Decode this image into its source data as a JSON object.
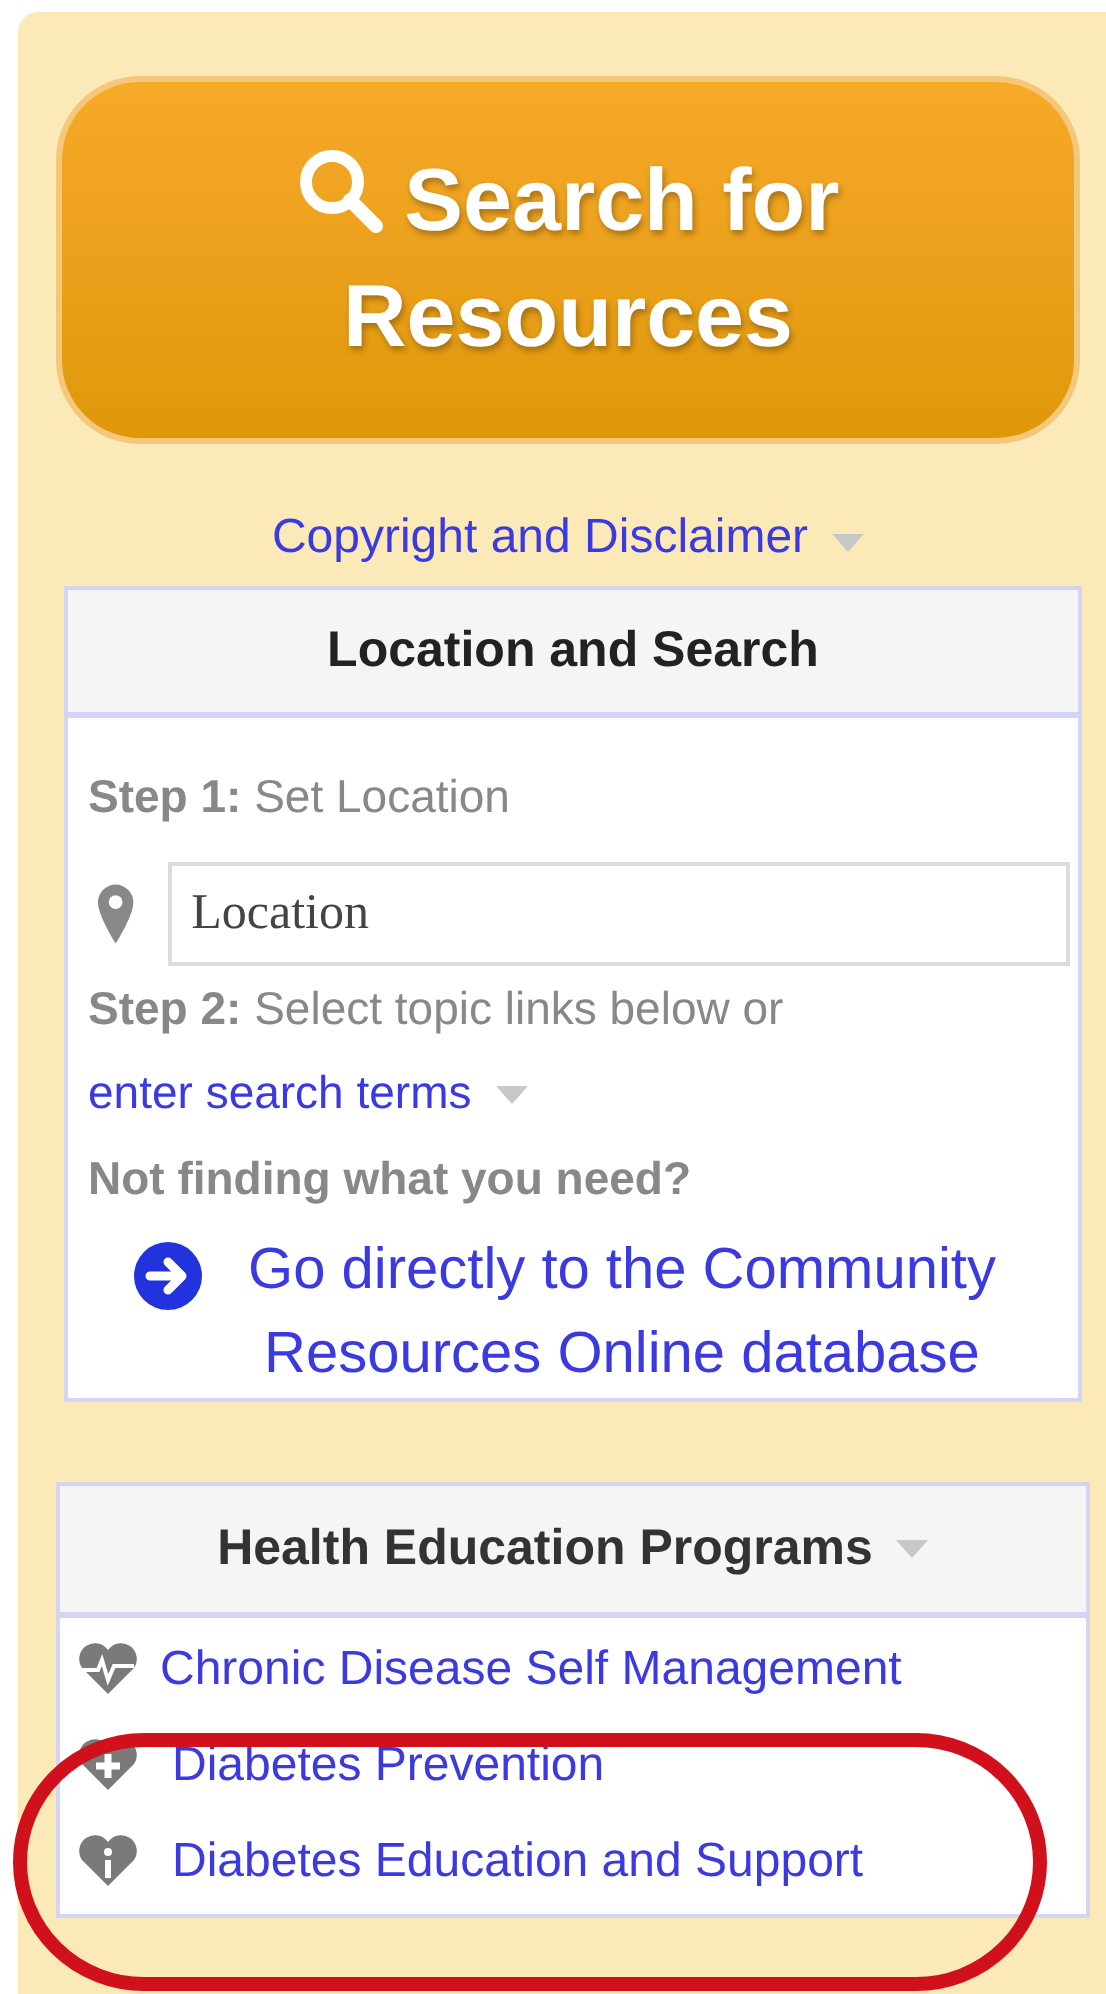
{
  "search_button": {
    "label": "Search for Resources"
  },
  "copyright_link": {
    "label": "Copyright and Disclaimer"
  },
  "location_panel": {
    "title": "Location and Search",
    "step1": {
      "label": "Step 1:",
      "text": "Set Location"
    },
    "location_field": {
      "placeholder": "Location"
    },
    "step2": {
      "label": "Step 2:",
      "text": "Select topic links below or"
    },
    "search_terms_link": "enter search terms",
    "not_finding": "Not finding what you need?",
    "database_link": "Go directly to the Community Resources Online database"
  },
  "programs_panel": {
    "title": "Health Education Programs",
    "items": [
      {
        "label": "Chronic Disease Self Management",
        "kind": "pulse"
      },
      {
        "label": "Diabetes Prevention",
        "kind": "plus"
      },
      {
        "label": "Diabetes Education and Support",
        "kind": "info"
      }
    ]
  },
  "annotation": {
    "kind": "ellipse"
  }
}
